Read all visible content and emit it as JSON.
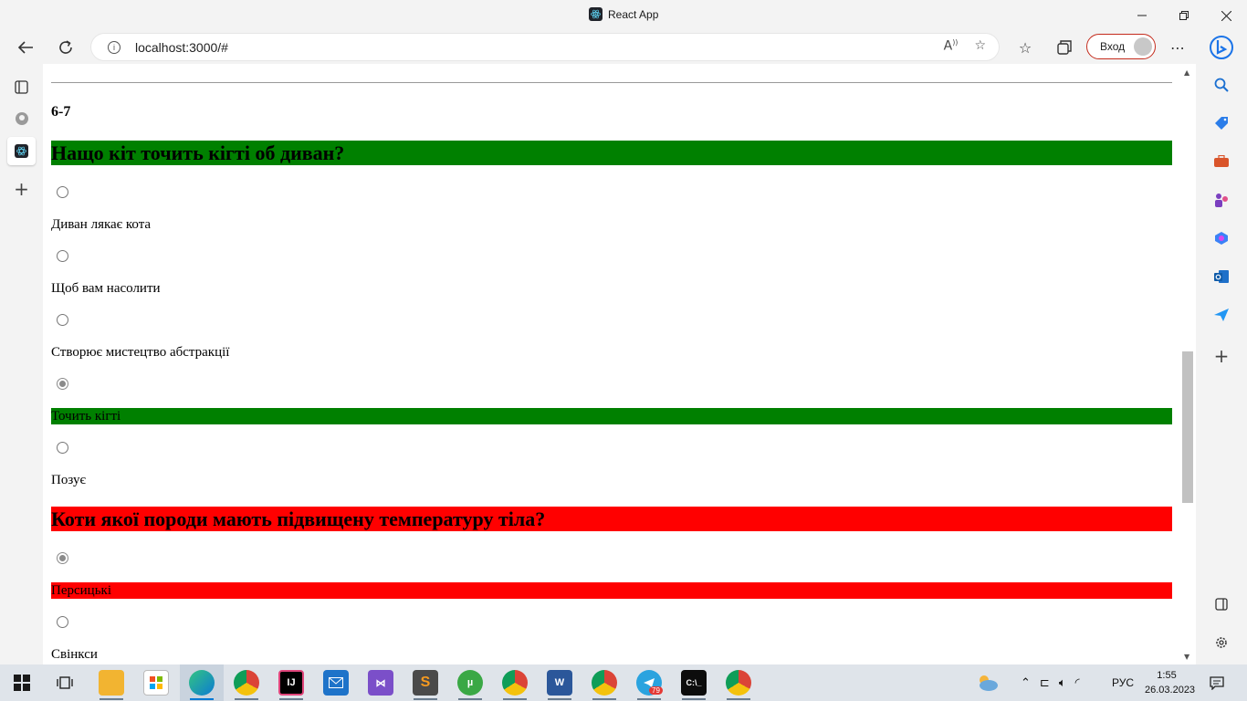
{
  "browser": {
    "tab_title": "React App",
    "url": "localhost:3000/#",
    "login_label": "Вход",
    "window_controls": [
      "minimize-icon",
      "restore-icon",
      "close-icon"
    ]
  },
  "page": {
    "grade": "6-7",
    "questions": [
      {
        "title": "Нащо кіт точить кігті об диван?",
        "status_color": "#008000",
        "answers": [
          {
            "label": "Диван лякає кота",
            "checked": false,
            "highlight": ""
          },
          {
            "label": "Щоб вам насолити",
            "checked": false,
            "highlight": ""
          },
          {
            "label": "Створює мистецтво абстракції",
            "checked": false,
            "highlight": ""
          },
          {
            "label": "Точить кігті",
            "checked": true,
            "highlight": "#008000"
          },
          {
            "label": "Позує",
            "checked": false,
            "highlight": ""
          }
        ]
      },
      {
        "title": "Коти якої породи мають підвищену температуру тіла?",
        "status_color": "#ff0000",
        "answers": [
          {
            "label": "Перcицькі",
            "checked": true,
            "highlight": "#ff0000"
          },
          {
            "label": "Свінкси",
            "checked": false,
            "highlight": ""
          }
        ]
      }
    ]
  },
  "taskbar": {
    "language": "РУС",
    "time": "1:55",
    "date": "26.03.2023",
    "telegram_badge": "79"
  }
}
